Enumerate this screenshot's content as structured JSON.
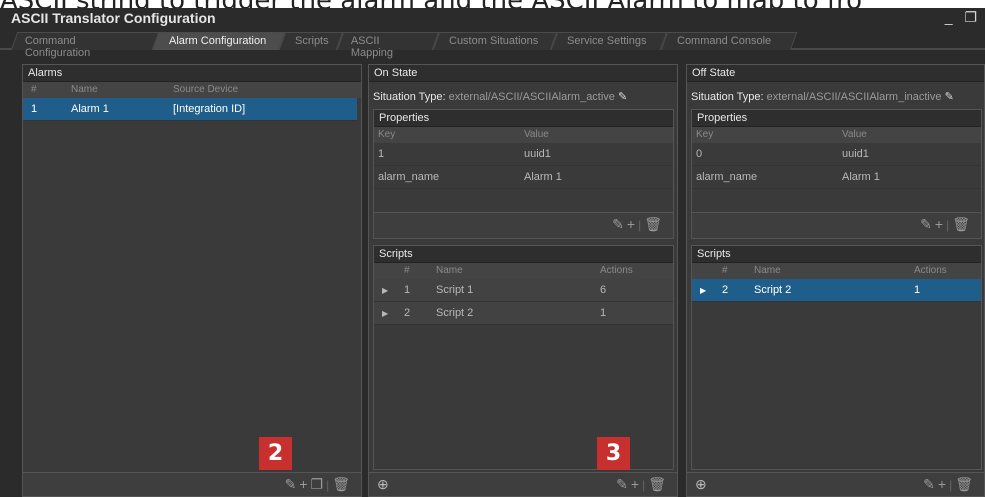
{
  "caption": "ASCII string to trigger the alarm and the ASCII Alarm to map to fro",
  "window": {
    "title": "ASCII Translator Configuration",
    "controls": "_ ❐"
  },
  "tabs": [
    {
      "label": "Command Configuration"
    },
    {
      "label": "Alarm Configuration"
    },
    {
      "label": "Scripts"
    },
    {
      "label": "ASCII Mapping"
    },
    {
      "label": "Custom Situations"
    },
    {
      "label": "Service Settings"
    },
    {
      "label": "Command Console"
    }
  ],
  "alarms": {
    "header": "Alarms",
    "columns": {
      "num": "#",
      "name": "Name",
      "source": "Source Device"
    },
    "rows": [
      {
        "num": "1",
        "name": "Alarm 1",
        "source": "[Integration ID]"
      }
    ],
    "badge": "2"
  },
  "on_state": {
    "header": "On State",
    "situation_label": "Situation Type:",
    "situation_value": "external/ASCII/ASCIIAlarm_active",
    "properties": {
      "header": "Properties",
      "columns": {
        "key": "Key",
        "value": "Value"
      },
      "rows": [
        {
          "key": "1",
          "value": "uuid1"
        },
        {
          "key": "alarm_name",
          "value": "Alarm 1"
        }
      ]
    },
    "scripts": {
      "header": "Scripts",
      "columns": {
        "num": "#",
        "name": "Name",
        "actions": "Actions"
      },
      "rows": [
        {
          "num": "1",
          "name": "Script 1",
          "actions": "6"
        },
        {
          "num": "2",
          "name": "Script 2",
          "actions": "1"
        }
      ]
    },
    "badge": "3"
  },
  "off_state": {
    "header": "Off State",
    "situation_label": "Situation Type:",
    "situation_value": "external/ASCII/ASCIIAlarm_inactive",
    "properties": {
      "header": "Properties",
      "columns": {
        "key": "Key",
        "value": "Value"
      },
      "rows": [
        {
          "key": "0",
          "value": "uuid1"
        },
        {
          "key": "alarm_name",
          "value": "Alarm 1"
        }
      ]
    },
    "scripts": {
      "header": "Scripts",
      "columns": {
        "num": "#",
        "name": "Name",
        "actions": "Actions"
      },
      "rows": [
        {
          "num": "2",
          "name": "Script 2",
          "actions": "1"
        }
      ]
    }
  },
  "colors": {
    "selection": "#1f5e8a",
    "badge": "#c8302f",
    "background": "#2b2b2b"
  }
}
